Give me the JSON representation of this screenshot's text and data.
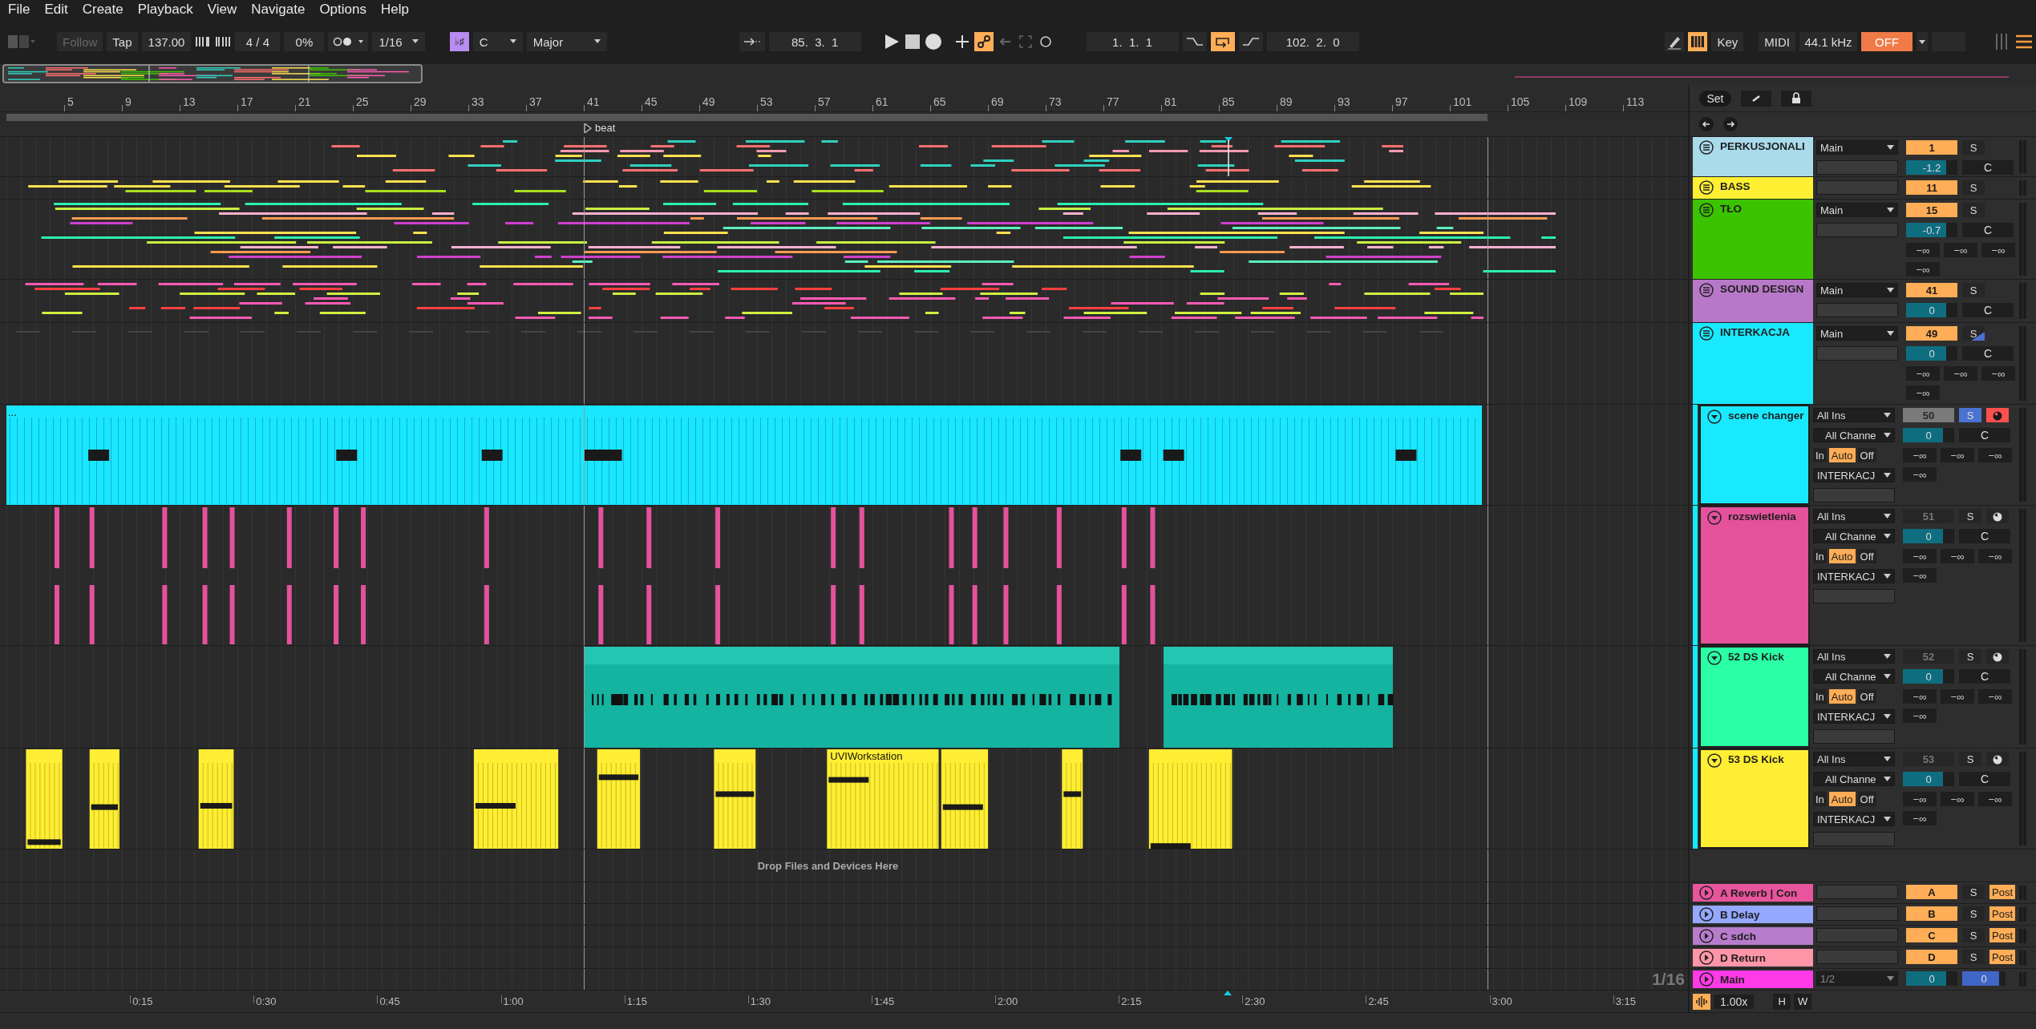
{
  "menu": [
    "File",
    "Edit",
    "Create",
    "Playback",
    "View",
    "Navigate",
    "Options",
    "Help"
  ],
  "toolbar": {
    "follow": {
      "label": "Follow",
      "on": false
    },
    "tap": "Tap",
    "tempo": "137.00",
    "time_signature": "4 / 4",
    "groove": "0%",
    "quantization": "1/16",
    "scale_on": true,
    "scale_glyph": "♭♯",
    "root": "C",
    "scale": "Major",
    "position": "85.  3.  1",
    "link_on": true,
    "loop_start": "1.  1.  1",
    "loop_on": true,
    "loop_length": "102.  2.  0",
    "draw_mode_on": false,
    "computer_keyboard_on": true,
    "key_label": "Key",
    "midi_label": "MIDI",
    "sample_rate": "44.1 kHz",
    "cpu_label": "OFF"
  },
  "arrangement": {
    "ruler_bars": [
      "5",
      "9",
      "13",
      "17",
      "21",
      "25",
      "29",
      "33",
      "37",
      "41",
      "45",
      "49",
      "53",
      "57",
      "61",
      "65",
      "69",
      "73",
      "77",
      "81",
      "85",
      "89",
      "93",
      "97",
      "101",
      "105",
      "109",
      "113"
    ],
    "locator": "beat",
    "drop_hint": "Drop Files and Devices Here",
    "grid": "1/16",
    "time_ruler": [
      "0:15",
      "0:30",
      "0:45",
      "1:00",
      "1:15",
      "1:30",
      "1:45",
      "2:00",
      "2:15",
      "2:30",
      "2:45",
      "3:00",
      "3:15"
    ]
  },
  "set_button": "Set",
  "tracks": [
    {
      "kind": "group",
      "name": "PERKUSJONALI",
      "color": "#a9dbeb",
      "output": "Main",
      "activator": {
        "label": "1",
        "on": true
      },
      "solo": {
        "label": "S",
        "on": false,
        "implied": false
      },
      "volume": {
        "value": "-1.2",
        "level": 0.78
      },
      "crossfade": "C"
    },
    {
      "kind": "group",
      "name": "BASS",
      "color": "#fff034",
      "activator": {
        "label": "11",
        "on": true
      },
      "solo": {
        "label": "S",
        "on": false,
        "implied": false
      }
    },
    {
      "kind": "group",
      "name": "TŁO",
      "color": "#3cc300",
      "output": "Main",
      "activator": {
        "label": "15",
        "on": true
      },
      "solo": {
        "label": "S",
        "on": false,
        "implied": false
      },
      "volume": {
        "value": "-0.7",
        "level": 0.78
      },
      "crossfade": "C",
      "sends": [
        "−∞",
        "−∞",
        "−∞",
        "−∞"
      ]
    },
    {
      "kind": "group",
      "name": "SOUND DESIGN",
      "color": "#b878c8",
      "output": "Main",
      "activator": {
        "label": "41",
        "on": true
      },
      "solo": {
        "label": "S",
        "on": false,
        "implied": false
      },
      "volume": {
        "value": "0",
        "level": 0.78
      },
      "crossfade": "C"
    },
    {
      "kind": "group",
      "name": "INTERKACJA",
      "color": "#19e9ff",
      "output": "Main",
      "activator": {
        "label": "49",
        "on": true
      },
      "solo": {
        "label": "S",
        "on": false,
        "implied": true
      },
      "volume": {
        "value": "0",
        "level": 0.78
      },
      "crossfade": "C",
      "sends": [
        "−∞",
        "−∞",
        "−∞",
        "−∞"
      ],
      "children": [
        {
          "kind": "midi",
          "name": "scene changer",
          "color": "#19e9ff",
          "selected": true,
          "clip_label": "...",
          "input": "All Ins",
          "input_channel": "All Channe",
          "monitor": [
            {
              "label": "In",
              "selected": false
            },
            {
              "label": "Auto",
              "selected": true
            },
            {
              "label": "Off",
              "selected": false
            }
          ],
          "output": "INTERKACJ",
          "activator": {
            "label": "50",
            "on": false
          },
          "solo": {
            "label": "S",
            "on": true,
            "implied": false
          },
          "arm": true,
          "volume": {
            "value": "0",
            "level": 0.78
          },
          "crossfade": "C",
          "sends": [
            "−∞",
            "−∞",
            "−∞",
            "−∞"
          ]
        },
        {
          "kind": "midi",
          "name": "rozswietlenia",
          "color": "#e4529c",
          "selected": false,
          "input": "All Ins",
          "input_channel": "All Channe",
          "monitor": [
            {
              "label": "In",
              "selected": false
            },
            {
              "label": "Auto",
              "selected": true
            },
            {
              "label": "Off",
              "selected": false
            }
          ],
          "output": "INTERKACJ",
          "activator": {
            "label": "51",
            "on": false
          },
          "solo": {
            "label": "S",
            "on": false,
            "implied": false
          },
          "arm": false,
          "volume": {
            "value": "0",
            "level": 0.78
          },
          "crossfade": "C",
          "sends": [
            "−∞",
            "−∞",
            "−∞",
            "−∞"
          ]
        },
        {
          "kind": "midi",
          "name": "52 DS Kick",
          "color": "#2bffa6",
          "selected": false,
          "input": "All Ins",
          "input_channel": "All Channe",
          "monitor": [
            {
              "label": "In",
              "selected": false
            },
            {
              "label": "Auto",
              "selected": true
            },
            {
              "label": "Off",
              "selected": false
            }
          ],
          "output": "INTERKACJ",
          "activator": {
            "label": "52",
            "on": false
          },
          "solo": {
            "label": "S",
            "on": false,
            "implied": false
          },
          "arm": false,
          "volume": {
            "value": "0",
            "level": 0.78
          },
          "crossfade": "C",
          "sends": [
            "−∞",
            "−∞",
            "−∞",
            "−∞"
          ]
        },
        {
          "kind": "midi",
          "name": "53 DS Kick",
          "color": "#ffee33",
          "selected": false,
          "clip_label": "UVIWorkstation",
          "input": "All Ins",
          "input_channel": "All Channe",
          "monitor": [
            {
              "label": "In",
              "selected": false
            },
            {
              "label": "Auto",
              "selected": true
            },
            {
              "label": "Off",
              "selected": false
            }
          ],
          "output": "INTERKACJ",
          "activator": {
            "label": "53",
            "on": false
          },
          "solo": {
            "label": "S",
            "on": false,
            "implied": false
          },
          "arm": false,
          "volume": {
            "value": "0",
            "level": 0.78
          },
          "crossfade": "C",
          "sends": [
            "−∞",
            "−∞",
            "−∞",
            "−∞"
          ]
        }
      ]
    }
  ],
  "returns": [
    {
      "name": "A Reverb | Con",
      "color": "#e8559c",
      "activator": {
        "label": "A",
        "on": true
      },
      "solo": {
        "label": "S",
        "on": false,
        "implied": false
      },
      "post": {
        "label": "Post",
        "on": true
      }
    },
    {
      "name": "B Delay",
      "color": "#94a8ff",
      "activator": {
        "label": "B",
        "on": true
      },
      "solo": {
        "label": "S",
        "on": false,
        "implied": false
      },
      "post": {
        "label": "Post",
        "on": true
      }
    },
    {
      "name": "C sdch",
      "color": "#b77ccc",
      "activator": {
        "label": "C",
        "on": true
      },
      "solo": {
        "label": "S",
        "on": false,
        "implied": false
      },
      "post": {
        "label": "Post",
        "on": true
      }
    },
    {
      "name": "D Return",
      "color": "#ff95a8",
      "activator": {
        "label": "D",
        "on": true
      },
      "solo": {
        "label": "S",
        "on": false,
        "implied": false
      },
      "post": {
        "label": "Post",
        "on": true
      }
    }
  ],
  "main": {
    "name": "Main",
    "color": "#ff3ae6",
    "output": "1/2",
    "volume": {
      "value": "0",
      "level": 0.78
    },
    "cue": {
      "value": "0",
      "level": 0.85
    }
  },
  "footer": {
    "zoom": "1.00x",
    "h_button": "H",
    "w_button": "W"
  }
}
